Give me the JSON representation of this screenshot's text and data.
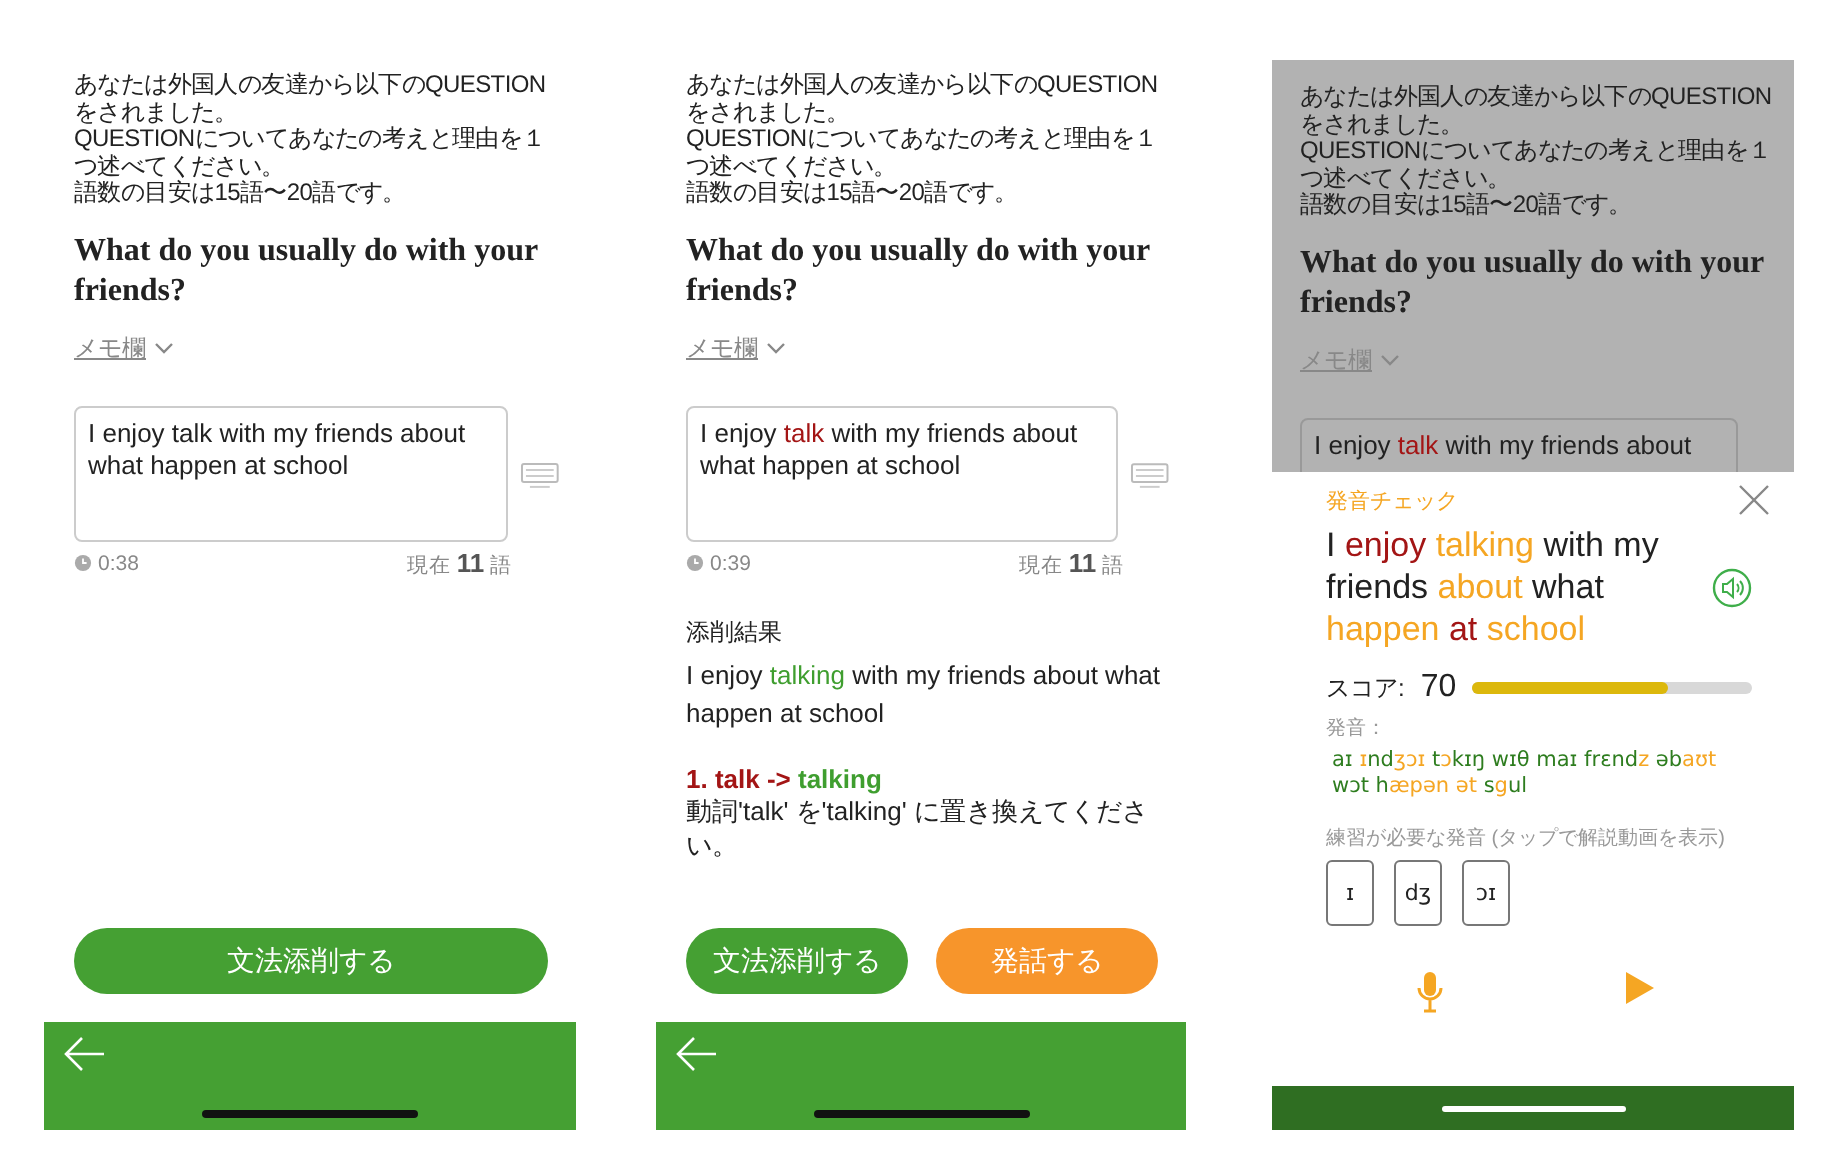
{
  "screens": [
    {
      "kind": "editor",
      "instructions": [
        "あなたは外国人の友達から以下のQUESTIONをされました。",
        "QUESTIONについてあなたの考えと理由を１つ述べてください。",
        "語数の目安は15語〜20語です。"
      ],
      "question": "What do you usually do with your friends?",
      "memo_label": "メモ欄",
      "answer": [
        {
          "text": "I enjoy talk with my friends about what happen at school",
          "color": "#222222"
        }
      ],
      "timer": "0:38",
      "word_count": "現在 **11** 語",
      "buttons": [
        {
          "label": "文法添削する",
          "kind": "green"
        }
      ]
    },
    {
      "kind": "editor",
      "instructions": [
        "あなたは外国人の友達から以下のQUESTIONをされました。",
        "QUESTIONについてあなたの考えと理由を１つ述べてください。",
        "語数の目安は15語〜20語です。"
      ],
      "question": "What do you usually do with your friends?",
      "memo_label": "メモ欄",
      "answer": [
        {
          "text": "I enjoy ",
          "color": "#222222"
        },
        {
          "text": "talk",
          "color": "#a31515"
        },
        {
          "text": " with my friends about what happen at school",
          "color": "#222222"
        }
      ],
      "timer": "0:39",
      "word_count": "現在 **11** 語",
      "result": {
        "label": "添削結果",
        "corrected": [
          {
            "text": "I enjoy ",
            "color": "#222222"
          },
          {
            "text": "talking",
            "color": "#3f9e2f"
          },
          {
            "text": " with my friends about what happen at school",
            "color": "#222222"
          }
        ],
        "correction": [
          {
            "text": "1. talk -> ",
            "color": "#a31515"
          },
          {
            "text": "talking",
            "color": "#3f9e2f"
          }
        ],
        "explanation": "動詞'talk' を'talking' に置き換えてください。"
      },
      "buttons": [
        {
          "label": "文法添削する",
          "kind": "green"
        },
        {
          "label": "発話する",
          "kind": "orange"
        }
      ]
    },
    {
      "kind": "pronunciation",
      "instructions": [
        "あなたは外国人の友達から以下のQUESTIONをされました。",
        "QUESTIONについてあなたの考えと理由を１つ述べてください。",
        "語数の目安は15語〜20語です。"
      ],
      "question": "What do you usually do with your friends?",
      "memo_label": "メモ欄",
      "answer": [
        {
          "text": "I enjoy ",
          "color": "#222222"
        },
        {
          "text": "talk",
          "color": "#a31515"
        },
        {
          "text": " with my friends about",
          "color": "#222222"
        }
      ],
      "sheet": {
        "title": "発音チェック",
        "sentence": [
          {
            "text": "I ",
            "color": "#222222"
          },
          {
            "text": "enjoy ",
            "color": "#a31515"
          },
          {
            "text": "talking ",
            "color": "#f5a623"
          },
          {
            "text": "with my friends ",
            "color": "#222222"
          },
          {
            "text": "about ",
            "color": "#f5a623"
          },
          {
            "text": "what ",
            "color": "#222222"
          },
          {
            "text": "happen ",
            "color": "#f5a623"
          },
          {
            "text": "at ",
            "color": "#a31515"
          },
          {
            "text": "school",
            "color": "#f5a623"
          }
        ],
        "score_label": "スコア:",
        "score": "70",
        "level": 0.7,
        "pron_label": "発音：",
        "ipa": [
          {
            "text": "aɪ ",
            "color": "#2e7d1f"
          },
          {
            "text": "ɪ",
            "color": "#f5a623"
          },
          {
            "text": "nd",
            "color": "#2e7d1f"
          },
          {
            "text": "ʒɔɪ",
            "color": "#f5a623"
          },
          {
            "text": " t",
            "color": "#2e7d1f"
          },
          {
            "text": "ɔ",
            "color": "#f5a623"
          },
          {
            "text": "kɪŋ wɪθ maɪ frɛnd",
            "color": "#2e7d1f"
          },
          {
            "text": "z",
            "color": "#f5a623"
          },
          {
            "text": "  əb",
            "color": "#2e7d1f"
          },
          {
            "text": "aʊt",
            "color": "#f5a623"
          },
          {
            "text": " wɔt h",
            "color": "#2e7d1f"
          },
          {
            "text": "æpən ət",
            "color": "#f5a623"
          },
          {
            "text": " s",
            "color": "#2e7d1f"
          },
          {
            "text": "g",
            "color": "#f5a623"
          },
          {
            "text": "ul",
            "color": "#2e7d1f"
          }
        ],
        "practice_label": "練習が必要な発音 (タップで解説動画を表示)",
        "phonemes": [
          "ɪ",
          "dʒ",
          "ɔɪ"
        ]
      }
    }
  ]
}
